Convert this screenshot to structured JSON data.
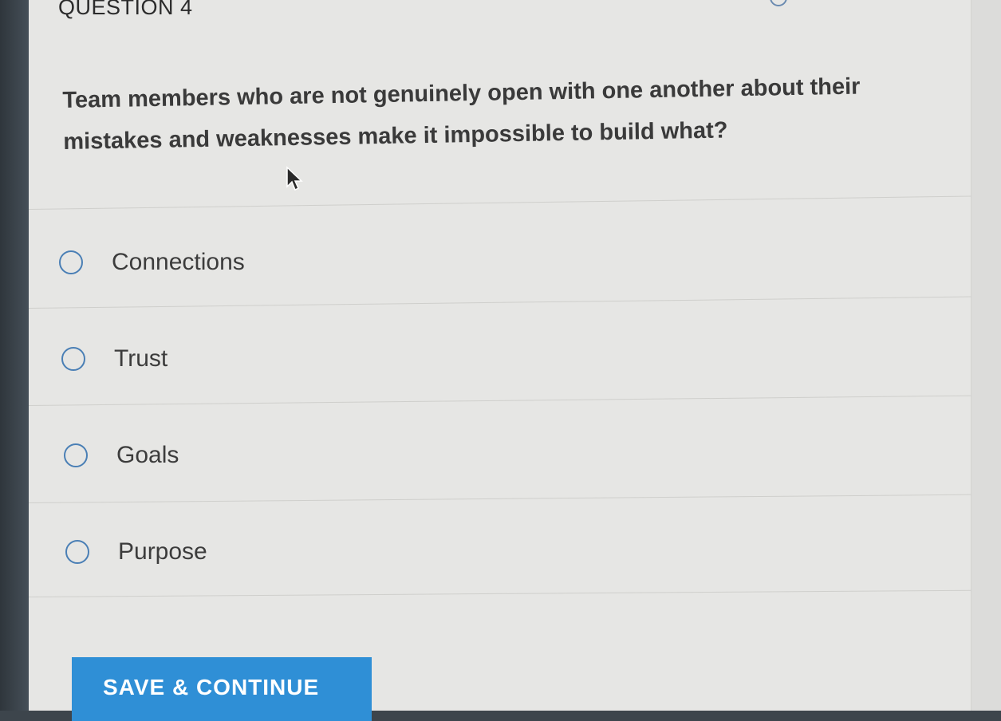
{
  "question": {
    "number_label": "QUESTION 4",
    "prompt": "Team members who are not genuinely open with one another about their mistakes and weaknesses make it impossible to build what?"
  },
  "options": [
    {
      "label": "Connections",
      "selected": false
    },
    {
      "label": "Trust",
      "selected": false
    },
    {
      "label": "Goals",
      "selected": false
    },
    {
      "label": "Purpose",
      "selected": false
    }
  ],
  "actions": {
    "save_label": "SAVE & CONTINUE"
  },
  "colors": {
    "accent": "#2f8fd6",
    "radio_border": "#4a7fb5",
    "panel_bg": "#e6e6e4"
  }
}
